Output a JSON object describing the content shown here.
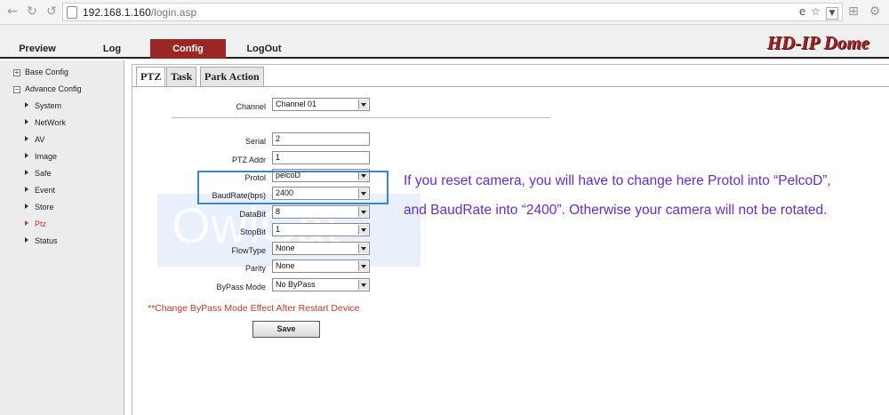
{
  "browser": {
    "url_host": "192.168.1.160",
    "url_path": "/login.asp"
  },
  "menu": {
    "items": [
      "Preview",
      "Log",
      "Config",
      "LogOut"
    ],
    "active": "Config",
    "brand": "HD-IP Dome"
  },
  "sidebar": {
    "groups": [
      "Base Config",
      "Advance Config"
    ],
    "items": [
      "System",
      "NetWork",
      "AV",
      "Image",
      "Safe",
      "Event",
      "Store",
      "Ptz",
      "Status"
    ],
    "active": "Ptz"
  },
  "tabs": [
    "PTZ",
    "Task",
    "Park Action"
  ],
  "form": {
    "channel_label": "Channel",
    "channel_value": "Channel 01",
    "serial_label": "Serial",
    "serial_value": "2",
    "ptz_addr_label": "PTZ Addr",
    "ptz_addr_value": "1",
    "protol_label": "Protol",
    "protol_value": "pelcoD",
    "baudrate_label": "BaudRate(bps)",
    "baudrate_value": "2400",
    "databit_label": "DataBit",
    "databit_value": "8",
    "stopbit_label": "StopBit",
    "stopbit_value": "1",
    "flowtype_label": "FlowType",
    "flowtype_value": "None",
    "parity_label": "Parity",
    "parity_value": "None",
    "bypass_label": "ByPass Mode",
    "bypass_value": "No ByPass",
    "warning": "**Change ByPass Mode Effect After Restart Device",
    "save_label": "Save"
  },
  "annotation": {
    "line1": "If you reset camera, you will have to change here Protol into “PelcoD”,",
    "line2": "and BaudRate into “2400”. Otherwise your camera will not be rotated."
  },
  "watermark": "OwlCat",
  "colors": {
    "accent": "#9b2626",
    "highlight": "#3a86c8",
    "annotation": "#6a2bd1",
    "warning": "#c0392b"
  }
}
